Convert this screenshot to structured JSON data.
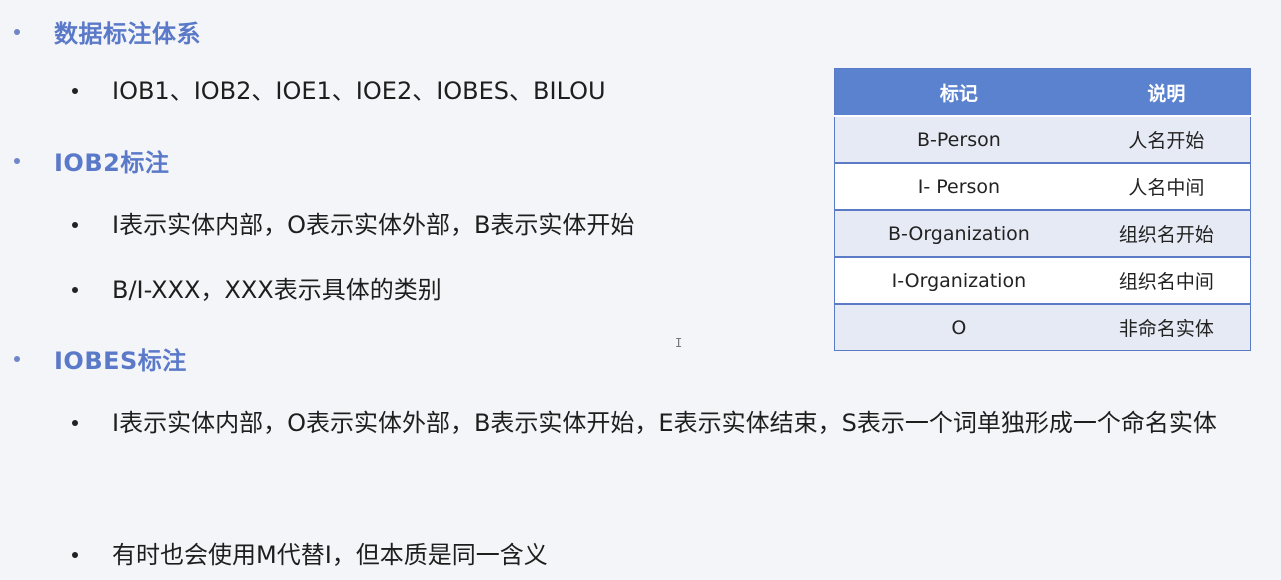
{
  "sections": [
    {
      "heading": "数据标注体系",
      "items": [
        "IOB1、IOB2、IOE1、IOE2、IOBES、BILOU"
      ]
    },
    {
      "heading": "IOB2标注",
      "items": [
        "I表示实体内部，O表示实体外部，B表示实体开始",
        "B/I-XXX，XXX表示具体的类别"
      ]
    },
    {
      "heading": "IOBES标注",
      "items": [
        "I表示实体内部，O表示实体外部，B表示实体开始，E表示实体结束，S表示一个词单独形成一个命名实体",
        "有时也会使用M代替I，但本质是同一含义"
      ]
    }
  ],
  "table": {
    "headers": [
      "标记",
      "说明"
    ],
    "rows": [
      [
        "B-Person",
        "人名开始"
      ],
      [
        "I- Person",
        "人名中间"
      ],
      [
        "B-Organization",
        "组织名开始"
      ],
      [
        "I-Organization",
        "组织名中间"
      ],
      [
        "O",
        "非命名实体"
      ]
    ]
  },
  "colors": {
    "heading": "#5a79c9",
    "table_header": "#5b82cf",
    "table_stripe": "#e6eaf4"
  }
}
